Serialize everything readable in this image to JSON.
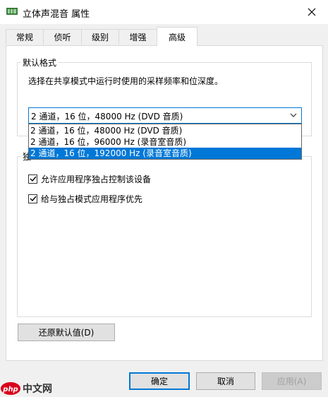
{
  "window": {
    "title": "立体声混音 属性",
    "close_glyph": "✕"
  },
  "tabs": [
    {
      "label": "常规",
      "active": false
    },
    {
      "label": "侦听",
      "active": false
    },
    {
      "label": "级别",
      "active": false
    },
    {
      "label": "增强",
      "active": false
    },
    {
      "label": "高级",
      "active": true
    }
  ],
  "default_format": {
    "group_label": "默认格式",
    "description": "选择在共享模式中运行时使用的采样频率和位深度。",
    "selected_value": "2 通道，16 位，48000 Hz (DVD 音质)",
    "options": [
      {
        "label": "2 通道，16 位，48000 Hz (DVD 音质)",
        "highlighted": false
      },
      {
        "label": "2 通道，16 位，96000 Hz (录音室音质)",
        "highlighted": false
      },
      {
        "label": "2 通道，16 位，192000 Hz (录音室音质)",
        "highlighted": true
      }
    ]
  },
  "exclusive_mode": {
    "group_label_visible": "独",
    "checkboxes": [
      {
        "label": "允许应用程序独占控制该设备",
        "checked": true
      },
      {
        "label": "给与独占模式应用程序优先",
        "checked": true
      }
    ]
  },
  "buttons": {
    "restore_defaults": "还原默认值(D)",
    "ok": "确定",
    "cancel": "取消",
    "apply": "应用(A)"
  },
  "watermark": {
    "text": "中文网",
    "logo_text": "php"
  },
  "colors": {
    "accent": "#0078d7",
    "watermark_red": "#d9001b"
  }
}
